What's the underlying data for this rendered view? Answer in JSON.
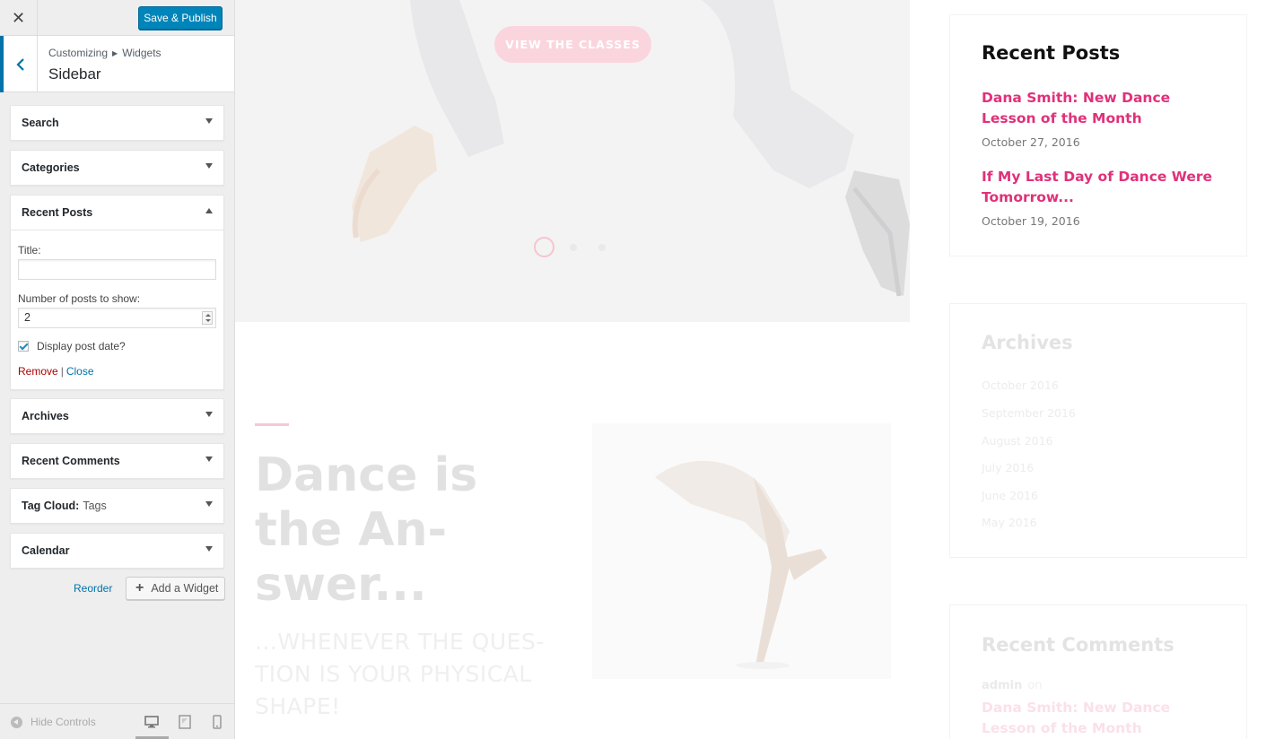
{
  "customizer": {
    "close_label": "✕",
    "save_label": "Save & Publish",
    "breadcrumb": {
      "root": "Customizing",
      "parent": "Widgets"
    },
    "section_title": "Sidebar",
    "widgets": [
      {
        "name": "Search"
      },
      {
        "name": "Categories"
      },
      {
        "name": "Recent Posts"
      },
      {
        "name": "Archives"
      },
      {
        "name": "Recent Comments"
      },
      {
        "name": "Tag Cloud:",
        "subtitle": "Tags"
      },
      {
        "name": "Calendar"
      }
    ],
    "recent_posts_form": {
      "title_label": "Title:",
      "title_value": "",
      "count_label": "Number of posts to show:",
      "count_value": "2",
      "show_date_label": "Display post date?",
      "show_date_checked": true,
      "remove_label": "Remove",
      "separator": "|",
      "close_label": "Close"
    },
    "reorder_label": "Reorder",
    "add_widget_label": "Add a Widget",
    "hide_controls_label": "Hide Controls",
    "devices": [
      "desktop-icon",
      "tablet-icon",
      "mobile-icon"
    ],
    "active_device": "desktop"
  },
  "preview": {
    "hero_button": "VIEW THE CLASSES",
    "slider_dots": 3,
    "active_slide": 1,
    "headline": "Dance is the An­swer...",
    "subhead": "...WHENEVER THE QUES­TION IS YOUR PHYSICAL SHAPE!",
    "recent_posts": {
      "title": "Recent Posts",
      "posts": [
        {
          "title": "Dana Smith: New Dance Lesson of the Month",
          "date": "October 27, 2016"
        },
        {
          "title": "If My Last Day of Dance Were Tomorrow...",
          "date": "October 19, 2016"
        }
      ]
    },
    "archives": {
      "title": "Archives",
      "items": [
        "October 2016",
        "September 2016",
        "August 2016",
        "July 2016",
        "June 2016",
        "May 2016"
      ]
    },
    "recent_comments": {
      "title": "Recent Comments",
      "author": "admin",
      "on": "on",
      "post": "Dana Smith: New Dance Lesson of the Month"
    }
  },
  "colors": {
    "accent_blue": "#0085ba",
    "link_pink": "#e0317a",
    "remove_red": "#aa0000"
  }
}
